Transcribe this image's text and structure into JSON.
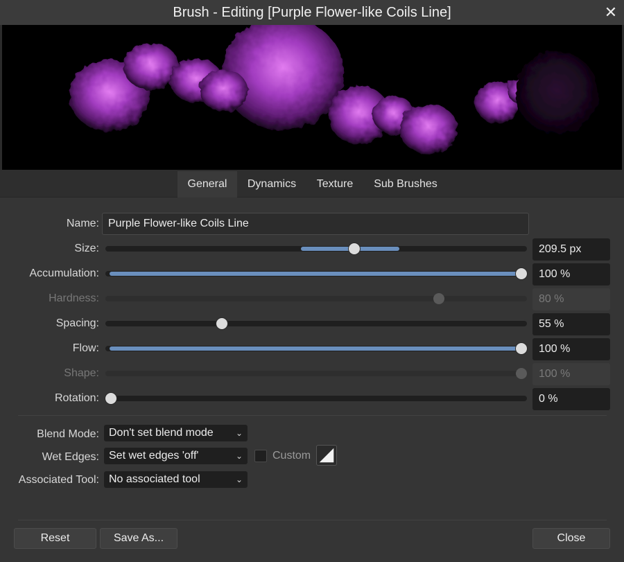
{
  "window": {
    "title": "Brush - Editing [Purple Flower-like Coils Line]",
    "close_icon": "close-icon"
  },
  "tabs": [
    {
      "label": "General",
      "active": true
    },
    {
      "label": "Dynamics",
      "active": false
    },
    {
      "label": "Texture",
      "active": false
    },
    {
      "label": "Sub Brushes",
      "active": false
    }
  ],
  "general": {
    "name_label": "Name:",
    "name_value": "Purple Flower-like Coils Line",
    "size": {
      "label": "Size:",
      "value": "209.5 px",
      "level": 0.59
    },
    "accumulation": {
      "label": "Accumulation:",
      "value": "100 %",
      "level": 1.0
    },
    "hardness": {
      "label": "Hardness:",
      "value": "80 %",
      "level": 0.8,
      "enabled": false
    },
    "spacing": {
      "label": "Spacing:",
      "value": "55 %",
      "level": 0.28
    },
    "flow": {
      "label": "Flow:",
      "value": "100 %",
      "level": 1.0
    },
    "shape": {
      "label": "Shape:",
      "value": "100 %",
      "level": 1.0,
      "enabled": false
    },
    "rotation": {
      "label": "Rotation:",
      "value": "0 %",
      "level": 0.0
    }
  },
  "options": {
    "blend_mode_label": "Blend Mode:",
    "blend_mode_value": "Don't set blend mode",
    "wet_edges_label": "Wet Edges:",
    "wet_edges_value": "Set wet edges 'off'",
    "custom_label": "Custom",
    "custom_checked": false,
    "associated_tool_label": "Associated Tool:",
    "associated_tool_value": "No associated tool"
  },
  "buttons": {
    "reset": "Reset",
    "save_as": "Save As...",
    "close": "Close"
  },
  "colors": {
    "accent": "#6a8fbd",
    "brush_tint": "#a23cc0"
  }
}
